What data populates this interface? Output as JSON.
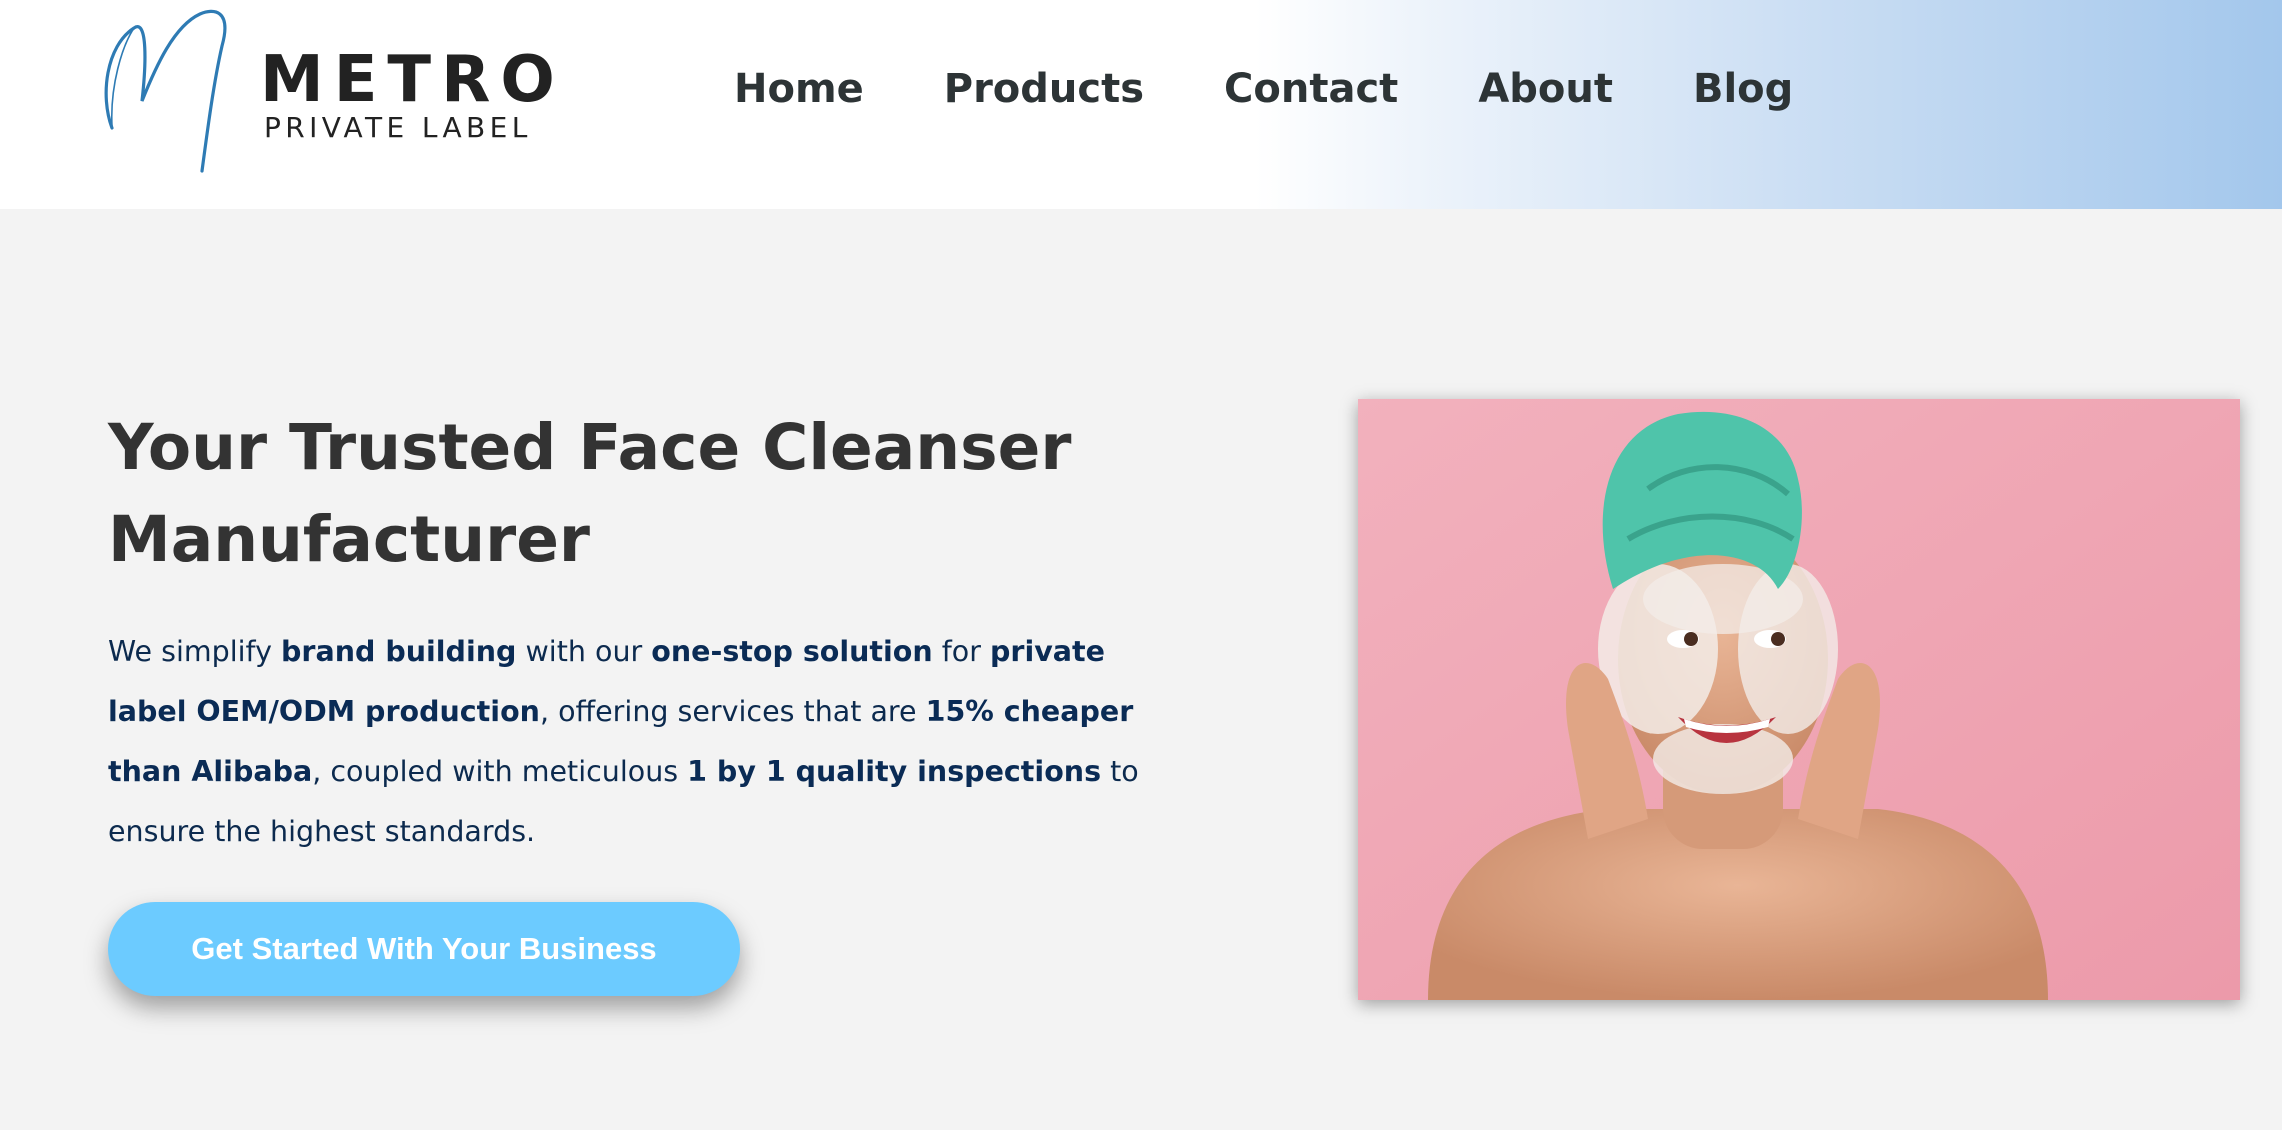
{
  "brand": {
    "name": "METRO",
    "tagline": "PRIVATE LABEL",
    "logo_icon": "script-m-logo-icon",
    "accent_color": "#2e7bb4"
  },
  "nav": {
    "items": [
      {
        "label": "Home"
      },
      {
        "label": "Products"
      },
      {
        "label": "Contact"
      },
      {
        "label": "About"
      },
      {
        "label": "Blog"
      }
    ]
  },
  "hero": {
    "title": "Your Trusted Face Cleanser Manufacturer",
    "description": {
      "t1": "We simplify ",
      "b1": "brand building",
      "t2": " with our ",
      "b2": "one-stop solution",
      "t3": " for ",
      "b3": "private label OEM/ODM production",
      "t4": ", offering services that are ",
      "b4": "15% cheaper than Alibaba",
      "t5": ", coupled with meticulous ",
      "b5": "1 by 1 quality inspections",
      "t6": " to ensure the highest standards."
    },
    "cta_label": "Get Started With Your Business",
    "cta_color": "#6ccbff",
    "image_subject": "woman-with-towel-and-face-foam-photo"
  },
  "colors": {
    "background": "#f3f3f3",
    "header_gradient_end": "#a3c7ec",
    "text_dark": "#333333",
    "text_navy": "#0a2b55"
  }
}
